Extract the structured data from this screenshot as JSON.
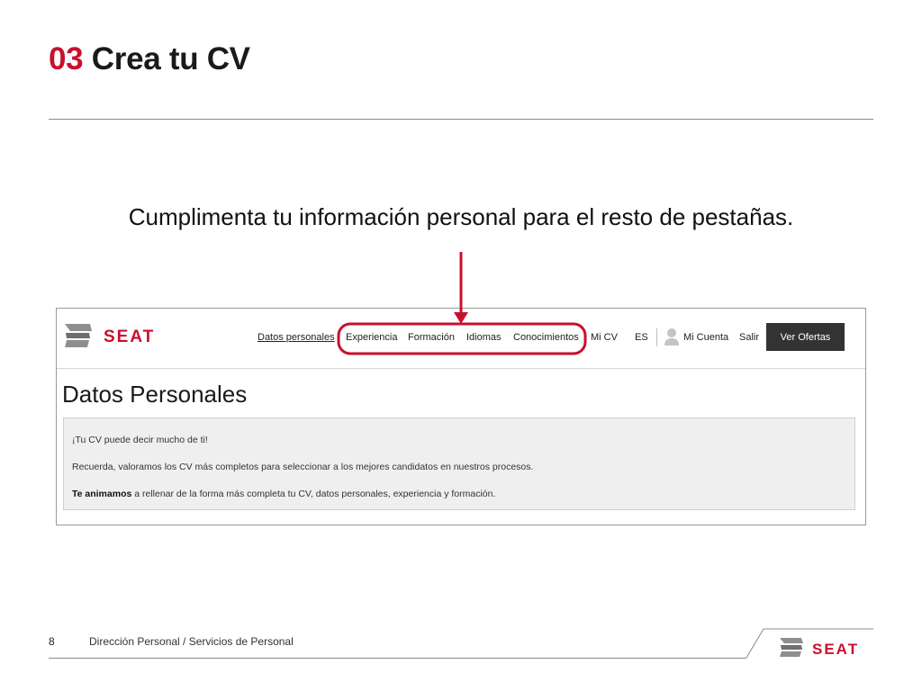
{
  "slide": {
    "number": "03",
    "title": "Crea tu CV",
    "instruction": "Cumplimenta tu información personal para el resto de pestañas."
  },
  "portal": {
    "logo_text": "SEAT",
    "nav": {
      "datos_personales": "Datos personales",
      "experiencia": "Experiencia",
      "formacion": "Formación",
      "idiomas": "Idiomas",
      "conocimientos": "Conocimientos",
      "mi_cv": "Mi CV",
      "language": "ES",
      "mi_cuenta": "Mi Cuenta",
      "salir": "Salir",
      "ver_ofertas": "Ver Ofertas"
    },
    "page_heading": "Datos Personales",
    "info": {
      "line1": "¡Tu CV puede decir mucho de ti!",
      "line2": "Recuerda, valoramos los CV más completos para seleccionar a los mejores candidatos en nuestros procesos.",
      "line3_bold": "Te animamos",
      "line3_rest": " a rellenar de la forma más completa tu CV, datos personales, experiencia y formación."
    }
  },
  "footer": {
    "page_number": "8",
    "text": "Dirección Personal / Servicios de Personal",
    "logo_text": "SEAT"
  },
  "colors": {
    "accent_red": "#c8102e",
    "button_dark": "#333333",
    "info_box_bg": "#efefef"
  }
}
